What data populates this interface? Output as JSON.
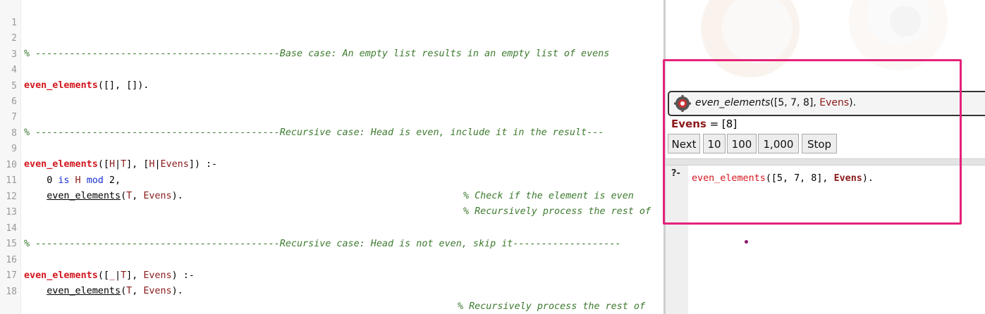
{
  "editor": {
    "lines": [
      {
        "n": "1"
      },
      {
        "n": "2",
        "comment": "% -------------------------------------------Base case: An empty list results in an empty list of evens"
      },
      {
        "n": "3"
      },
      {
        "n": "4",
        "pred": "even_elements",
        "rest": "([], [])."
      },
      {
        "n": "5"
      },
      {
        "n": "6"
      },
      {
        "n": "7",
        "comment": "% -------------------------------------------Recursive case: Head is even, include it in the result---"
      },
      {
        "n": "8"
      },
      {
        "n": "9",
        "pred": "even_elements",
        "a": "([",
        "v1": "H",
        "b": "|",
        "v2": "T",
        "c": "], [",
        "v3": "H",
        "d": "|",
        "v4": "Evens",
        "e": "]) :-"
      },
      {
        "n": "10",
        "num": "    0 ",
        "kw1": "is",
        "v5": " H ",
        "kw2": "mod",
        "tail": " 2,",
        "cmt": "% Check if the element is even"
      },
      {
        "n": "11",
        "call": "even_elements",
        "args_open": "(",
        "v6": "T",
        "sep": ", ",
        "v7": "Evens",
        "args_close": ").",
        "cmt": "% Recursively process the rest of"
      },
      {
        "n": "12"
      },
      {
        "n": "13"
      },
      {
        "n": "14",
        "comment": "% -------------------------------------------Recursive case: Head is not even, skip it-------------------"
      },
      {
        "n": "15"
      },
      {
        "n": "16",
        "pred": "even_elements",
        "a": "([",
        "v1": "_",
        "b": "|",
        "v2": "T",
        "c": "], ",
        "v3": "Evens",
        "d": ") :-"
      },
      {
        "n": "17",
        "call": "even_elements",
        "args_open": "(",
        "v6": "T",
        "sep": ", ",
        "v7": "Evens",
        "args_close": ").",
        "cmt": "% Recursively process the rest of"
      },
      {
        "n": "18"
      }
    ]
  },
  "answer": {
    "query_pred": "even_elements",
    "query_args": "([5, 7, 8], ",
    "query_var": "Evens",
    "query_end": ").",
    "result_var": "Evens",
    "result_eq": " = [8]"
  },
  "buttons": [
    "Next",
    "10",
    "100",
    "1,000",
    "Stop"
  ],
  "query": {
    "prompt": "?-",
    "pred": "even_elements",
    "args": "([5, 7, 8], ",
    "var": "Evens",
    "end": ")."
  },
  "colors": {
    "highlight": "#e4227a",
    "predicate": "#d3151c",
    "variable": "#8b1a1a",
    "comment": "#3c7a2e",
    "keyword": "#1a2fd3"
  }
}
